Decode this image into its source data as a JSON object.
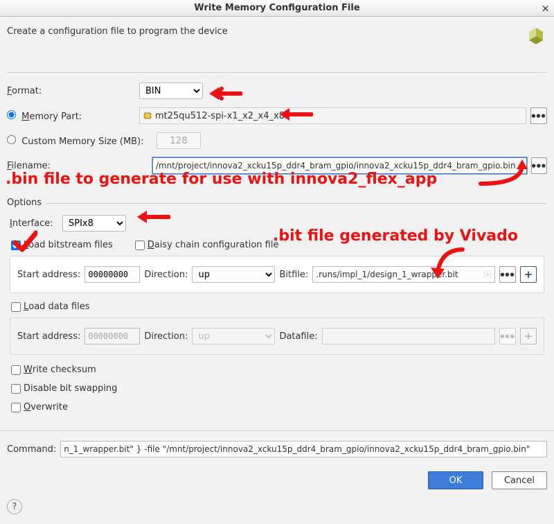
{
  "titlebar": {
    "title": "Write Memory Configuration File"
  },
  "header": {
    "subtitle": "Create a configuration file to program the device"
  },
  "labels": {
    "format": "ormat:",
    "memory_part": "emory Part:",
    "custom_size": "Custom Memory Size (MB):",
    "filename": "ilename:",
    "options": "Options",
    "interface": "Interface:",
    "load_bitstream": "oad bitstream files",
    "daisy_chain": "aisy chain configuration file",
    "start_address": "Start address:",
    "direction": "Direction:",
    "bitfile": "Bitfile:",
    "load_data": "oad data files",
    "datafile": "Datafile:",
    "write_checksum": "rite checksum",
    "disable_bit_swapping": "Disable bit swapping",
    "overwrite": "verwrite",
    "command": "Command:"
  },
  "values": {
    "format": "BIN",
    "memory_part": "mt25qu512-spi-x1_x2_x4_x8",
    "custom_size": "128",
    "filename": "/mnt/project/innova2_xcku15p_ddr4_bram_gpio/innova2_xcku15p_ddr4_bram_gpio.bin",
    "interface": "SPIx8",
    "load_bitstream_checked": true,
    "daisy_chain_checked": false,
    "start_address_bit": "00000000",
    "direction_bit": "up",
    "bitfile": ".runs/impl_1/design_1_wrapper.bit",
    "load_data_checked": false,
    "start_address_data": "00000000",
    "direction_data": "up",
    "datafile": "",
    "write_checksum_checked": false,
    "disable_bit_swapping_checked": false,
    "overwrite_checked": false,
    "command": "n_1_wrapper.bit\" } -file \"/mnt/project/innova2_xcku15p_ddr4_bram_gpio/innova2_xcku15p_ddr4_bram_gpio.bin\""
  },
  "buttons": {
    "ok": "OK",
    "cancel": "Cancel"
  },
  "annotations": {
    "bin_text": ".bin file to generate for use with innova2_flex_app",
    "bit_text": ".bit file generated by Vivado"
  }
}
